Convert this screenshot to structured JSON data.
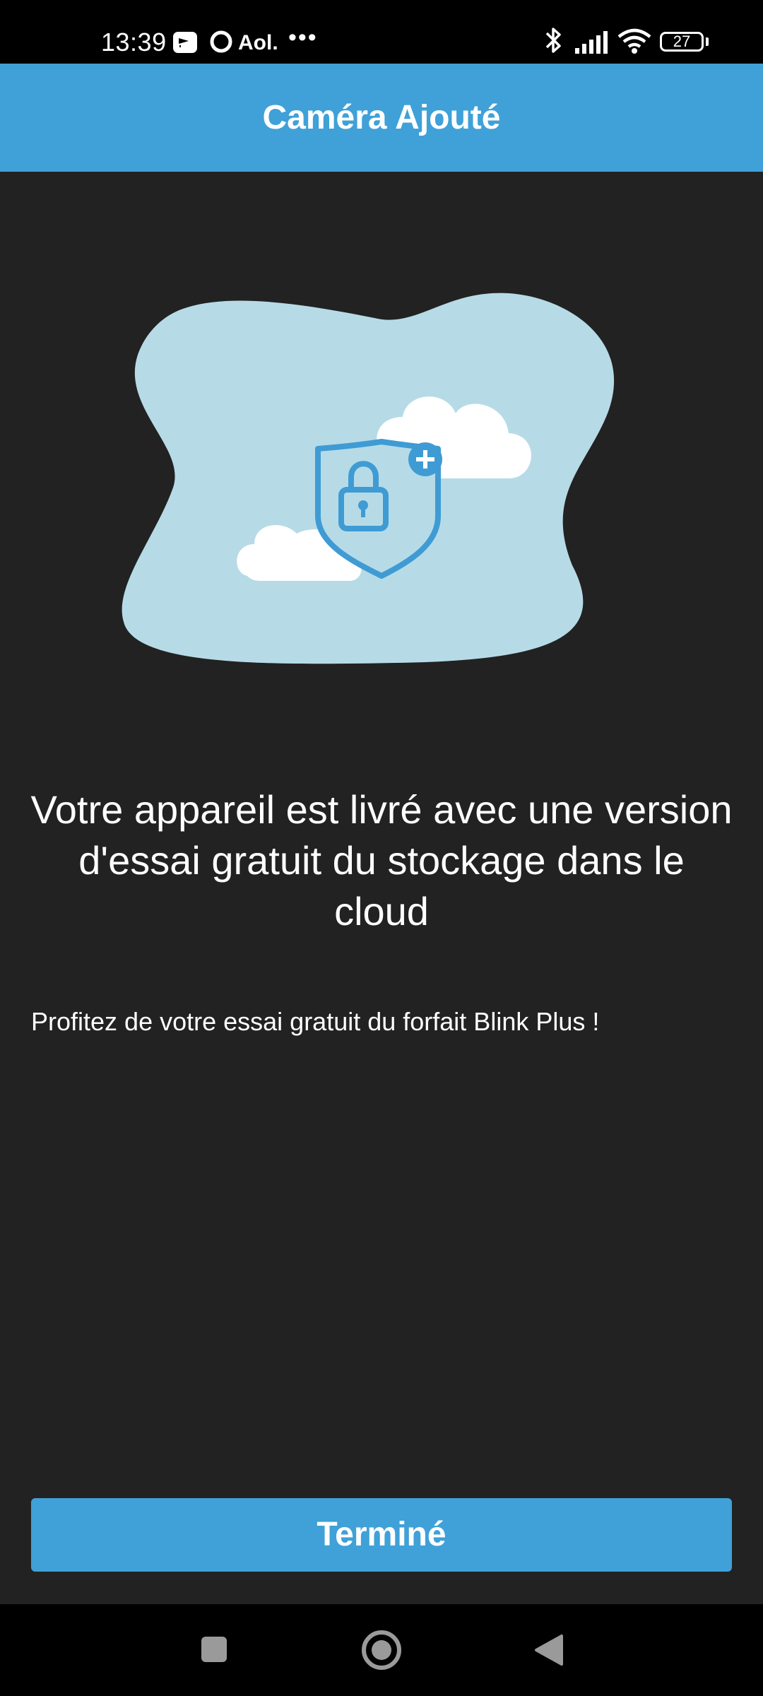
{
  "status_bar": {
    "time": "13:39",
    "carrier": "Aol.",
    "more": "•••",
    "battery_level": "27",
    "icons": [
      "screen-cast-icon",
      "circle-notification-icon",
      "bluetooth-icon",
      "cellular-signal-icon",
      "wifi-icon",
      "battery-icon"
    ]
  },
  "app_bar": {
    "title": "Caméra Ajouté"
  },
  "illustration": {
    "icons": [
      "cloud-icon",
      "shield-lock-icon",
      "plus-icon"
    ],
    "colors": {
      "blob": "#b6dbe7",
      "cloud": "#ffffff",
      "accent": "#3f9bd4"
    }
  },
  "content": {
    "headline": "Votre appareil est livré avec une version d'essai gratuit du stockage dans le cloud",
    "subtext": "Profitez de votre essai gratuit du forfait Blink Plus !"
  },
  "actions": {
    "done_label": "Terminé"
  },
  "nav_bar": {
    "icons": [
      "recents-square-icon",
      "home-circle-icon",
      "back-triangle-icon"
    ]
  },
  "colors": {
    "background": "#222222",
    "primary": "#3fa1d8",
    "text": "#ffffff"
  }
}
